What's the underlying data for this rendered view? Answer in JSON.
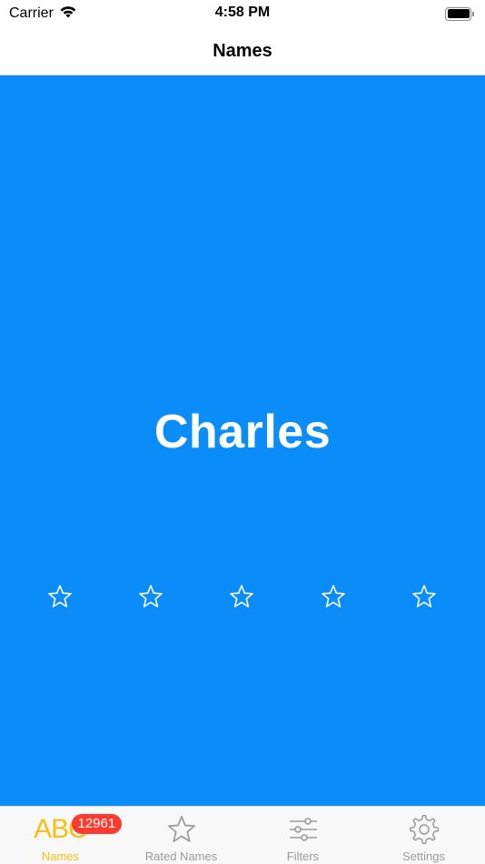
{
  "status_bar": {
    "carrier": "Carrier",
    "time": "4:58 PM"
  },
  "nav": {
    "title": "Names"
  },
  "card": {
    "name": "Charles",
    "background_color": "#0a8cf9",
    "rating": 0,
    "star_count": 5
  },
  "tab_bar": {
    "tabs": [
      {
        "label": "Names",
        "icon": "abc-icon",
        "icon_text": "ABC",
        "badge": "12961",
        "active": true
      },
      {
        "label": "Rated Names",
        "icon": "star-icon",
        "active": false
      },
      {
        "label": "Filters",
        "icon": "sliders-icon",
        "active": false
      },
      {
        "label": "Settings",
        "icon": "gear-icon",
        "active": false
      }
    ],
    "active_color": "#f5c010",
    "inactive_color": "#9a9a9a"
  }
}
